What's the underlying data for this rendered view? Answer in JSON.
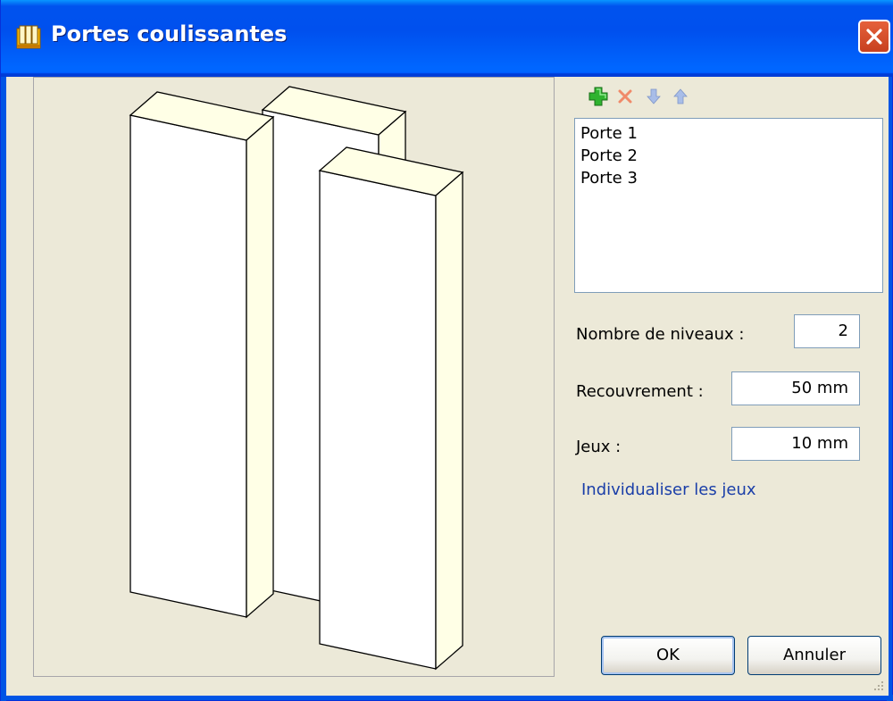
{
  "window": {
    "title": "Portes coulissantes"
  },
  "toolbar": {
    "add": "add-icon",
    "remove": "remove-icon",
    "move_down": "arrow-down-icon",
    "move_up": "arrow-up-icon"
  },
  "doors": {
    "items": [
      "Porte 1",
      "Porte 2",
      "Porte 3"
    ]
  },
  "form": {
    "levels_label": "Nombre de niveaux :",
    "levels_value": "2",
    "overlap_label": "Recouvrement :",
    "overlap_value": "50 mm",
    "gaps_label": "Jeux :",
    "gaps_value": "10 mm",
    "individual_gaps_link": "Individualiser les jeux"
  },
  "buttons": {
    "ok": "OK",
    "cancel": "Annuler"
  },
  "colors": {
    "titlebar": "#0055e5",
    "link": "#1a3ea8",
    "panel_side": "#ffffe6"
  }
}
